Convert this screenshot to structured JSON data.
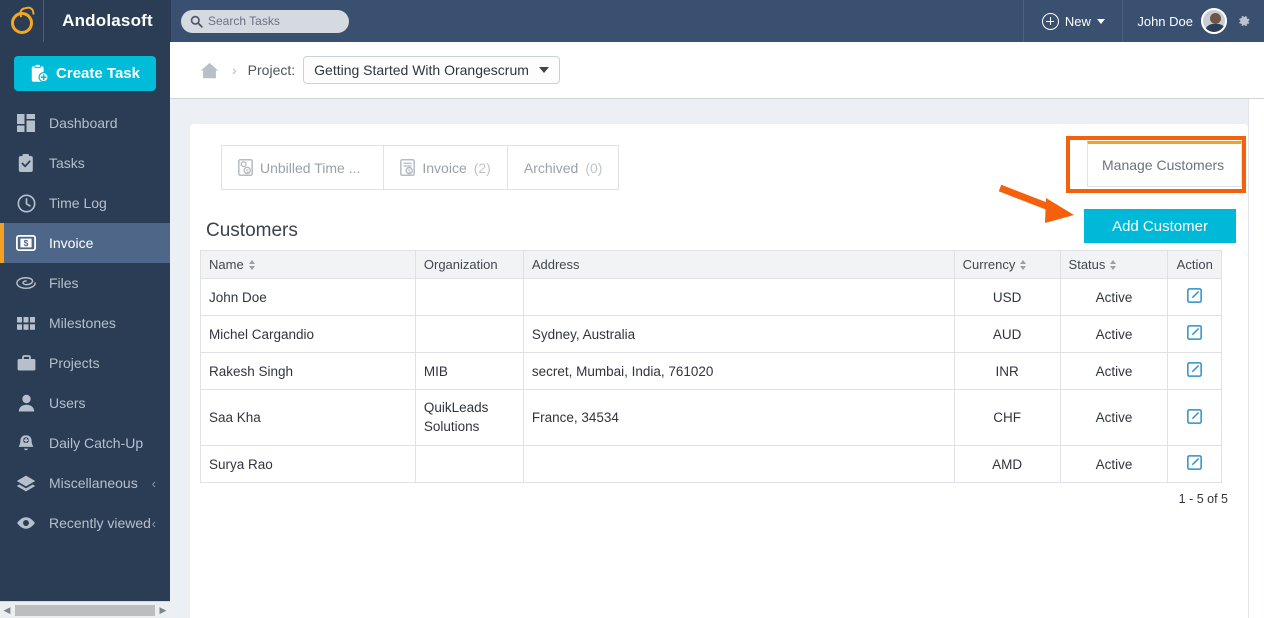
{
  "topbar": {
    "logo_icon": "orangescrum-ring-icon",
    "brand": "Andolasoft",
    "search": {
      "placeholder": "Search Tasks",
      "value": "",
      "icon": "search-icon"
    },
    "new_button": {
      "label": "New",
      "icon": "plus-circle-icon",
      "caret": "chevron-down-icon"
    },
    "user": {
      "name": "John Doe",
      "avatar": "user-avatar"
    },
    "settings_icon": "gear-icon"
  },
  "sidebar": {
    "create_task": {
      "label": "Create Task",
      "icon": "clipboard-plus-icon"
    },
    "items": [
      {
        "label": "Dashboard",
        "icon": "dashboard-grid-icon",
        "active": false,
        "chevron": ""
      },
      {
        "label": "Tasks",
        "icon": "clipboard-check-icon",
        "active": false,
        "chevron": ""
      },
      {
        "label": "Time Log",
        "icon": "clock-icon",
        "active": false,
        "chevron": ""
      },
      {
        "label": "Invoice",
        "icon": "dollar-card-icon",
        "active": true,
        "chevron": ""
      },
      {
        "label": "Files",
        "icon": "paperclip-icon",
        "active": false,
        "chevron": ""
      },
      {
        "label": "Milestones",
        "icon": "grid-blocks-icon",
        "active": false,
        "chevron": ""
      },
      {
        "label": "Projects",
        "icon": "briefcase-icon",
        "active": false,
        "chevron": ""
      },
      {
        "label": "Users",
        "icon": "person-icon",
        "active": false,
        "chevron": ""
      },
      {
        "label": "Daily Catch-Up",
        "icon": "bell-plus-icon",
        "active": false,
        "chevron": ""
      },
      {
        "label": "Miscellaneous",
        "icon": "layers-icon",
        "active": false,
        "chevron": "‹"
      },
      {
        "label": "Recently viewed",
        "icon": "eye-icon",
        "active": false,
        "chevron": "‹"
      }
    ],
    "scrollbar": {
      "left_arrow": "◀",
      "right_arrow": "▶"
    }
  },
  "breadcrumb": {
    "home_icon": "home-icon",
    "separator": "›",
    "label": "Project:",
    "project": "Getting Started With Orangescrum"
  },
  "tabs": [
    {
      "label": "Unbilled Time ...",
      "count": "",
      "icon": "unbilled-time-icon"
    },
    {
      "label": "Invoice",
      "count": "(2)",
      "icon": "invoice-doc-icon"
    },
    {
      "label": "Archived",
      "count": "(0)",
      "icon": ""
    }
  ],
  "manage_customers_tab": {
    "label": "Manage Customers"
  },
  "page": {
    "title": "Customers",
    "add_customer_label": "Add Customer",
    "pager": "1 - 5 of 5"
  },
  "table": {
    "columns": [
      {
        "label": "Name",
        "sortable": true
      },
      {
        "label": "Organization",
        "sortable": false
      },
      {
        "label": "Address",
        "sortable": false
      },
      {
        "label": "Currency",
        "sortable": true
      },
      {
        "label": "Status",
        "sortable": true
      },
      {
        "label": "Action",
        "sortable": false
      }
    ],
    "rows": [
      {
        "name": "John Doe",
        "organization": "",
        "address": "",
        "currency": "USD",
        "status": "Active",
        "action_icon": "edit-icon"
      },
      {
        "name": "Michel Cargandio",
        "organization": "",
        "address": "Sydney, Australia",
        "currency": "AUD",
        "status": "Active",
        "action_icon": "edit-icon"
      },
      {
        "name": "Rakesh Singh",
        "organization": "MIB",
        "address": "secret, Mumbai, India, 761020",
        "currency": "INR",
        "status": "Active",
        "action_icon": "edit-icon"
      },
      {
        "name": "Saa Kha",
        "organization": "QuikLeads Solutions",
        "address": "France, 34534",
        "currency": "CHF",
        "status": "Active",
        "action_icon": "edit-icon"
      },
      {
        "name": "Surya Rao",
        "organization": "",
        "address": "",
        "currency": "AMD",
        "status": "Active",
        "action_icon": "edit-icon"
      }
    ]
  },
  "annotations": {
    "highlight_color": "#f4600b",
    "arrow": "orange-arrow-pointing-to-add-customer"
  },
  "colors": {
    "topbar": "#3a5070",
    "sidebar": "#2b3d54",
    "accent_cyan": "#00bcd9",
    "accent_orange": "#f5a01e",
    "active_nav": "#4e6789",
    "annotation_orange": "#f4600b"
  }
}
